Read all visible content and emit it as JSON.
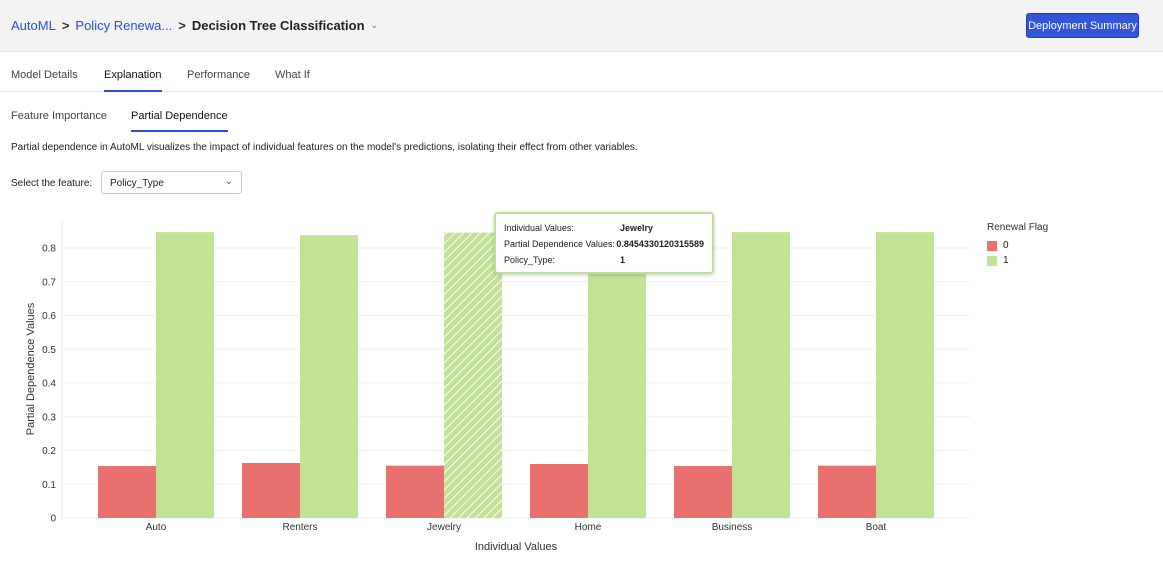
{
  "header": {
    "breadcrumbs": [
      "AutoML",
      "Policy Renewa..."
    ],
    "separator": ">",
    "current": "Decision Tree Classification",
    "deploy_button": "Deployment Summary"
  },
  "tabs": [
    "Model Details",
    "Explanation",
    "Performance",
    "What If"
  ],
  "active_tab": "Explanation",
  "subtabs": [
    "Feature Importance",
    "Partial Dependence"
  ],
  "description": "Partial dependence in AutoML visualizes the impact of individual features on the model's predictions, isolating their effect from other variables.",
  "feature_select": {
    "label": "Select the feature:",
    "value": "Policy_Type"
  },
  "tooltip": {
    "rows": [
      {
        "k": "Individual Values:",
        "v": "Jewelry"
      },
      {
        "k": "Partial Dependence Values:",
        "v": "0.8454330120315589"
      },
      {
        "k": "Policy_Type:",
        "v": "1"
      }
    ]
  },
  "colors": {
    "accent": "#2651d6",
    "series0": "#e8706e",
    "series1": "#c2e298"
  },
  "chart_data": {
    "type": "bar",
    "xlabel": "Individual Values",
    "ylabel": "Partial Dependence Values",
    "categories": [
      "Auto",
      "Renters",
      "Jewelry",
      "Home",
      "Business",
      "Boat"
    ],
    "ylim": [
      0,
      0.88
    ],
    "yticks": [
      "0",
      "0.1",
      "0.2",
      "0.3",
      "0.4",
      "0.5",
      "0.6",
      "0.7",
      "0.8"
    ],
    "grid": true,
    "legend": {
      "title": "Renewal Flag",
      "placement": "right"
    },
    "highlighted": {
      "category": "Jewelry",
      "series": "1"
    },
    "series": [
      {
        "name": "0",
        "values": [
          0.154,
          0.163,
          0.155,
          0.16,
          0.154,
          0.155
        ]
      },
      {
        "name": "1",
        "values": [
          0.847,
          0.838,
          0.8454330120315589,
          0.842,
          0.847,
          0.847
        ]
      }
    ]
  }
}
